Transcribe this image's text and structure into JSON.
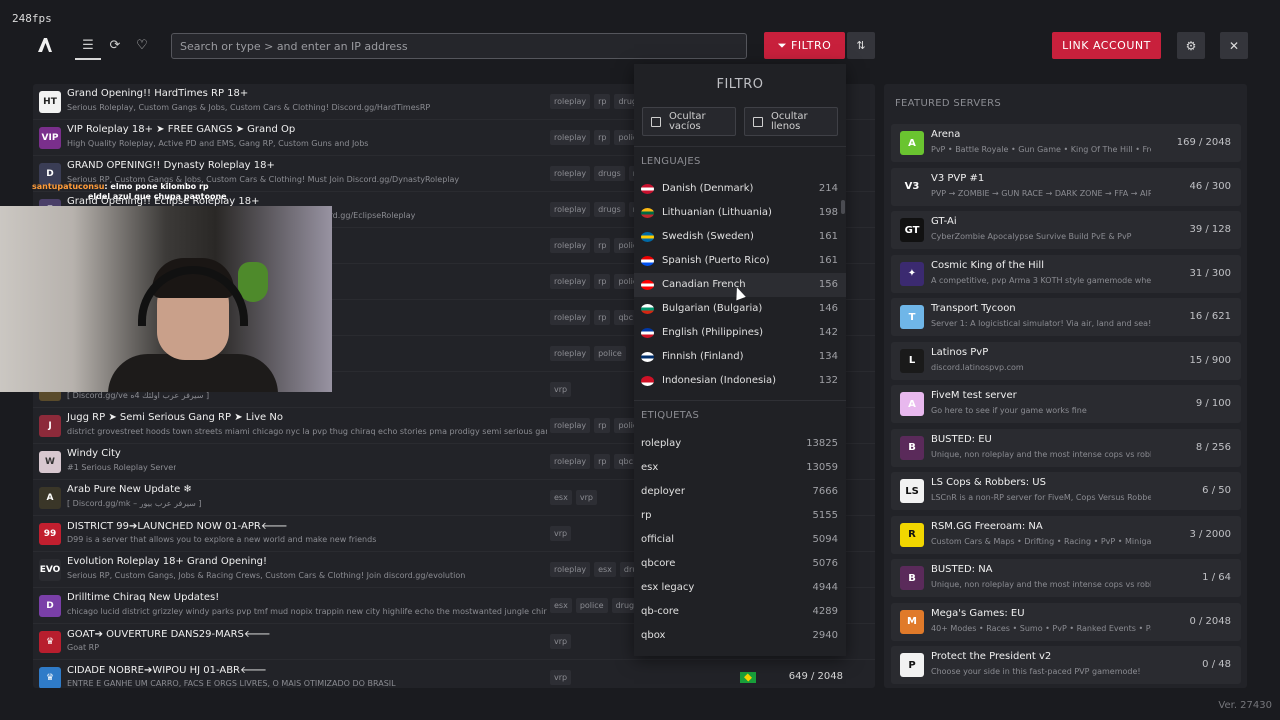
{
  "fps": "248fps",
  "colors": {
    "accent": "#c8203c",
    "panel": "#222328",
    "background": "#1a1b1f"
  },
  "topbar": {
    "search_placeholder": "Search or type > and enter an IP address",
    "filter_label": "FILTRO",
    "link_account_label": "LINK ACCOUNT",
    "icons": [
      "menu-icon",
      "history-icon",
      "heart-icon",
      "filter-icon",
      "sort-icon",
      "gear-icon",
      "close-icon"
    ]
  },
  "servers": [
    {
      "name": "Grand Opening!! HardTimes RP 18+",
      "desc": "Serious Roleplay, Custom Gangs & Jobs, Custom Cars & Clothing! Discord.gg/HardTimesRP",
      "tags": [
        "roleplay",
        "rp",
        "drug"
      ],
      "icon_color": "#f2f2f2",
      "icon_text": "HT",
      "icon_text_color": "#222"
    },
    {
      "name": "VIP Roleplay 18+ ➤ FREE GANGS ➤ Grand Op",
      "desc": "High Quality Roleplay, Active PD and EMS, Gang RP, Custom Guns and Jobs",
      "tags": [
        "roleplay",
        "rp",
        "polic"
      ],
      "icon_color": "#7a2f8c",
      "icon_text": "VIP"
    },
    {
      "name": "GRAND OPENING!! Dynasty Roleplay 18+",
      "desc": "Serious RP, Custom Gangs & Jobs, Custom Cars & Clothing! Must Join Discord.gg/DynastyRoleplay",
      "tags": [
        "roleplay",
        "drugs",
        "rp"
      ],
      "icon_color": "#3a3d55",
      "icon_text": "D"
    },
    {
      "name": "Grand Opening!! Eclipse Roleplay 18+",
      "desc": "Serious RP, Custom Gangs & Jobs, Custom Cars & Clothing! Discord.gg/EclipseRoleplay",
      "tags": [
        "roleplay",
        "drugs",
        "rp"
      ],
      "icon_color": "#4a3f68",
      "icon_text": "E"
    },
    {
      "name": "",
      "desc": "",
      "tags": [
        "roleplay",
        "rp",
        "polic"
      ],
      "icon_color": "#333",
      "icon_text": ""
    },
    {
      "name": "",
      "desc": "fence With No Detail Overlooked",
      "tags": [
        "roleplay",
        "rp",
        "polic"
      ],
      "icon_color": "#333",
      "icon_text": ""
    },
    {
      "name": "",
      "desc": "",
      "tags": [
        "roleplay",
        "rp",
        "qbc"
      ],
      "icon_color": "#333",
      "icon_text": ""
    },
    {
      "name": "",
      "desc": "ami chicago nyc la tmf rz pvp",
      "tags": [
        "roleplay",
        "police"
      ],
      "icon_color": "#333",
      "icon_text": ""
    },
    {
      "name": "",
      "desc": "[ Discord.gg/ve سيرفر عرب اولئك 4ه ]",
      "tags": [
        "vrp"
      ],
      "icon_color": "#5a4b2b",
      "icon_text": ""
    },
    {
      "name": "Jugg RP ➤ Semi Serious Gang RP ➤ Live No",
      "desc": "district grovestreet hoods town streets miami chicago nyc la pvp thug chiraq echo stories pma prodigy semi serious gang rp quasar",
      "tags": [
        "roleplay",
        "rp",
        "polic"
      ],
      "icon_color": "#8c2a3a",
      "icon_text": "J"
    },
    {
      "name": "Windy City",
      "desc": "#1 Serious Roleplay Server",
      "tags": [
        "roleplay",
        "rp",
        "qbc"
      ],
      "icon_color": "#d8c8d0",
      "icon_text": "W",
      "icon_text_color": "#333"
    },
    {
      "name": "Arab Pure New Update ❄",
      "desc": "[ Discord.gg/mk – سيرفر عرب بيور ]",
      "tags": [
        "esx",
        "vrp"
      ],
      "icon_color": "#3a3628",
      "icon_text": "A"
    },
    {
      "name": "DISTRICT 99➔LAUNCHED NOW 01-APR🡐",
      "desc": "D99 is a server that allows you to explore a new world and make new friends",
      "tags": [
        "vrp"
      ],
      "icon_color": "#c21f2f",
      "icon_text": "99"
    },
    {
      "name": "Evolution Roleplay 18+ Grand Opening!",
      "desc": "Serious RP, Custom Gangs, Jobs & Racing Crews, Custom Cars & Clothing! Join discord.gg/evolution",
      "tags": [
        "roleplay",
        "esx",
        "dru"
      ],
      "icon_color": "#2a2b30",
      "icon_text": "EVO"
    },
    {
      "name": "Drilltime Chiraq New Updates!",
      "desc": "chicago lucid district grizzley windy parks pvp tmf mud nopix trappin new city highlife echo the mostwanted jungle chiraq",
      "tags": [
        "esx",
        "police",
        "drug"
      ],
      "icon_color": "#7a3fa8",
      "icon_text": "D"
    },
    {
      "name": "GOAT➔ OUVERTURE DANS29-MARS🡐",
      "desc": "Goat RP",
      "tags": [
        "vrp"
      ],
      "icon_color": "#b81e2e",
      "icon_text": "♛"
    },
    {
      "name": "CIDADE NOBRE➔WIPOU HJ 01-ABR🡐",
      "desc": "ENTRE E GANHE UM CARRO, FACS E ORGS LIVRES, O MAIS OTIMIZADO DO BRASIL",
      "tags": [
        "vrp"
      ],
      "icon_color": "#2f7bc8",
      "icon_text": "♛",
      "players": "649 / 2048",
      "flag": "brazil-flag"
    }
  ],
  "chat_overlay": {
    "line1_user": "santupatuconsu",
    "line1_text": ": elmo pone kilombo rp",
    "line2_text": "eldel azul que chupa pantoone"
  },
  "filtro": {
    "title": "FILTRO",
    "hide_empty": "Ocultar vacíos",
    "hide_full": "Ocultar llenos",
    "languages_header": "LENGUAJES",
    "languages": [
      {
        "name": "Danish (Denmark)",
        "count": "214",
        "flag": [
          "#c8102e",
          "#ffffff",
          "#c8102e"
        ]
      },
      {
        "name": "Lithuanian (Lithuania)",
        "count": "198",
        "flag": [
          "#fdb913",
          "#006a44",
          "#c1272d"
        ]
      },
      {
        "name": "Swedish (Sweden)",
        "count": "161",
        "flag": [
          "#006aa7",
          "#fecc00",
          "#006aa7"
        ]
      },
      {
        "name": "Spanish (Puerto Rico)",
        "count": "161",
        "flag": [
          "#ed0000",
          "#ffffff",
          "#0050f0"
        ]
      },
      {
        "name": "Canadian French",
        "count": "156",
        "flag": [
          "#ff0000",
          "#ffffff",
          "#ff0000"
        ]
      },
      {
        "name": "Bulgarian (Bulgaria)",
        "count": "146",
        "flag": [
          "#ffffff",
          "#00966e",
          "#d62612"
        ]
      },
      {
        "name": "English (Philippines)",
        "count": "142",
        "flag": [
          "#0038a8",
          "#ffffff",
          "#ce1126"
        ]
      },
      {
        "name": "Finnish (Finland)",
        "count": "134",
        "flag": [
          "#ffffff",
          "#002f6c",
          "#ffffff"
        ]
      },
      {
        "name": "Indonesian (Indonesia)",
        "count": "132",
        "flag": [
          "#ce1126",
          "#ce1126",
          "#ffffff"
        ]
      }
    ],
    "tags_header": "ETIQUETAS",
    "tags": [
      {
        "name": "roleplay",
        "count": "13825"
      },
      {
        "name": "esx",
        "count": "13059"
      },
      {
        "name": "deployer",
        "count": "7666"
      },
      {
        "name": "rp",
        "count": "5155"
      },
      {
        "name": "official",
        "count": "5094"
      },
      {
        "name": "qbcore",
        "count": "5076"
      },
      {
        "name": "esx legacy",
        "count": "4944"
      },
      {
        "name": "qb-core",
        "count": "4289"
      },
      {
        "name": "qbox",
        "count": "2940"
      }
    ]
  },
  "featured": {
    "title": "FEATURED SERVERS",
    "items": [
      {
        "name": "Arena",
        "desc": "PvP • Battle Royale • Gun Game • King Of The Hill • Freeroam",
        "players": "169 / 2048",
        "icon_color": "#6ac430",
        "icon_text": "A"
      },
      {
        "name": "V3 PVP #1",
        "desc": "PVP → ZOMBIE → GUN RACE → DARK ZONE → FFA → AIRDROP",
        "players": "46 / 300",
        "icon_color": "#2a2b30",
        "icon_text": "V3"
      },
      {
        "name": "GT-Ai",
        "desc": "CyberZombie Apocalypse Survive Build PvE & PvP",
        "players": "39 / 128",
        "icon_color": "#111",
        "icon_text": "GT"
      },
      {
        "name": "Cosmic King of the Hill",
        "desc": "A competitive, pvp Arma 3 KOTH style gamemode where only the",
        "players": "31 / 300",
        "icon_color": "#3b2a70",
        "icon_text": "✦"
      },
      {
        "name": "Transport Tycoon",
        "desc": "Server 1: A logicistical simulator! Via air, land and sea!",
        "players": "16 / 621",
        "icon_color": "#6fb6e8",
        "icon_text": "T"
      },
      {
        "name": "Latinos PvP",
        "desc": "discord.latinospvp.com",
        "players": "15 / 900",
        "icon_color": "#1a1a1a",
        "icon_text": "L"
      },
      {
        "name": "FiveM test server",
        "desc": "Go here to see if your game works fine",
        "players": "9 / 100",
        "icon_color": "#e8b8ee",
        "icon_text": "A"
      },
      {
        "name": "BUSTED: EU",
        "desc": "Unique, non roleplay and the most intense cops vs robbers experience",
        "players": "8 / 256",
        "icon_color": "#5a2a5a",
        "icon_text": "B"
      },
      {
        "name": "LS Cops & Robbers: US",
        "desc": "LSCnR is a non-RP server for FiveM, Cops Versus Robbers freeroam",
        "players": "6 / 50",
        "icon_color": "#f2f2f2",
        "icon_text": "LS",
        "icon_text_color": "#111"
      },
      {
        "name": "RSM.GG Freeroam: NA",
        "desc": "Custom Cars & Maps • Drifting • Racing • PvP • Minigames • Freeroam",
        "players": "3 / 2000",
        "icon_color": "#f2d600",
        "icon_text": "R",
        "icon_text_color": "#111"
      },
      {
        "name": "BUSTED: NA",
        "desc": "Unique, non roleplay and the most intense cops vs robbers experience",
        "players": "1 / 64",
        "icon_color": "#5a2a5a",
        "icon_text": "B"
      },
      {
        "name": "Mega's Games: EU",
        "desc": "40+ Modes • Races • Sumo • PvP • Ranked Events • Parties • Freeroam",
        "players": "0 / 2048",
        "icon_color": "#e07a2a",
        "icon_text": "M"
      },
      {
        "name": "Protect the President v2",
        "desc": "Choose your side in this fast-paced PVP gamemode!",
        "players": "0 / 48",
        "icon_color": "#f2f2f2",
        "icon_text": "P",
        "icon_text_color": "#111"
      }
    ]
  },
  "version": "Ver. 27430"
}
